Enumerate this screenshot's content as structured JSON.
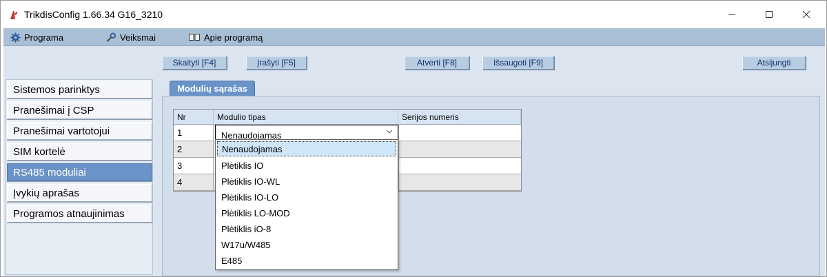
{
  "window": {
    "title": "TrikdisConfig 1.66.34   G16_3210",
    "min_icon": "minimize-icon",
    "max_icon": "maximize-icon",
    "close_icon": "close-icon"
  },
  "menu": {
    "programa": "Programa",
    "veiksmai": "Veiksmai",
    "apie": "Apie programą",
    "icons": [
      "gear-icon",
      "wrench-icon",
      "book-icon"
    ]
  },
  "toolbar": {
    "read": "Skaityti [F4]",
    "write": "Įrašyti [F5]",
    "open": "Atverti [F8]",
    "save": "Išsaugoti [F9]",
    "disconnect": "Atsijungti"
  },
  "nav": {
    "items": [
      "Sistemos parinktys",
      "Pranešimai į CSP",
      "Pranešimai vartotojui",
      "SIM kortelė",
      "RS485 moduliai",
      "Įvykių aprašas",
      "Programos atnaujinimas"
    ],
    "active_index": 4
  },
  "tab": {
    "label": "Modulių sąrašas"
  },
  "table": {
    "headers": [
      "Nr",
      "Modulio tipas",
      "Serijos numeris"
    ],
    "rows": [
      {
        "nr": "1",
        "type": "Nenaudojamas",
        "serial": ""
      },
      {
        "nr": "2",
        "type": "",
        "serial": ""
      },
      {
        "nr": "3",
        "type": "",
        "serial": ""
      },
      {
        "nr": "4",
        "type": "",
        "serial": ""
      }
    ]
  },
  "dropdown": {
    "options": [
      "Nenaudojamas",
      "Plėtiklis IO",
      "Plėtiklis IO-WL",
      "Plėtiklis IO-LO",
      "Plėtiklis LO-MOD",
      "Plėtiklis iO-8",
      "W17u/W485",
      "E485"
    ],
    "selected_index": 0
  },
  "colors": {
    "menubar": "#a9bfd6",
    "active_nav": "#6a93c8",
    "app_icon": "#c0392b"
  }
}
